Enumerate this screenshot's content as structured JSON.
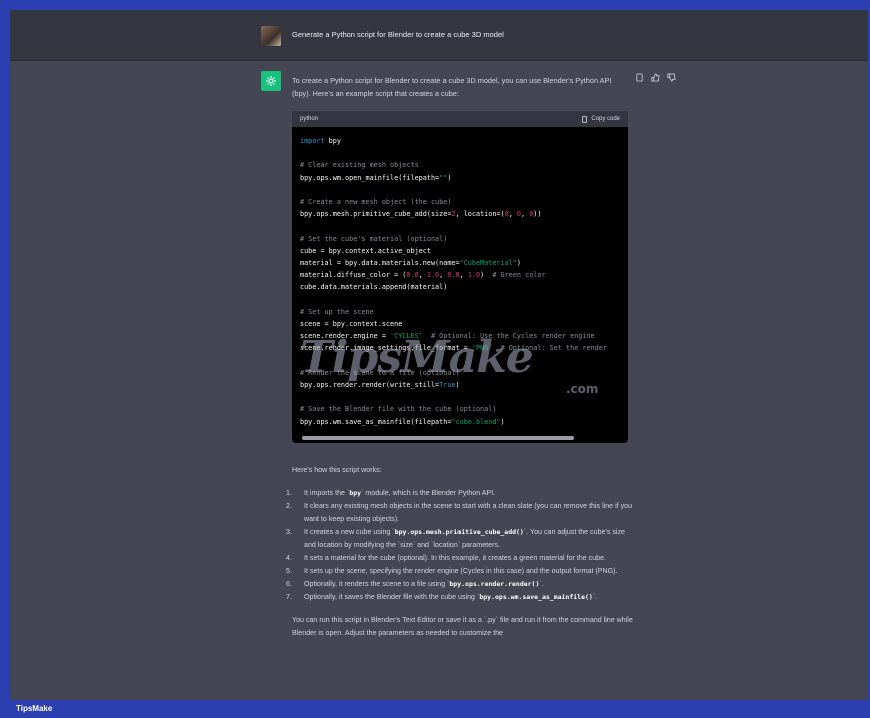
{
  "user_message": "Generate a Python script for Blender to create a cube 3D model",
  "intro": "To create a Python script for Blender to create a cube 3D model, you can use Blender's Python API (bpy). Here's an example script that creates a cube:",
  "code_block": {
    "language": "python",
    "copy_label": "Copy code"
  },
  "how_heading": "Here's how this script works:",
  "steps": [
    {
      "num": "1.",
      "pre": "It imports the `",
      "code": "bpy",
      "post": "` module, which is the Blender Python API."
    },
    {
      "num": "2.",
      "pre": "It clears any existing mesh objects in the scene to start with a clean slate (you can remove this line if you want to keep existing objects).",
      "code": "",
      "post": ""
    },
    {
      "num": "3.",
      "pre": "It creates a new cube using `",
      "code": "bpy.ops.mesh.primitive_cube_add()",
      "post": "`. You can adjust the cube's size and location by modifying the `size` and `location` parameters."
    },
    {
      "num": "4.",
      "pre": "It sets a material for the cube (optional). In this example, it creates a green material for the cube.",
      "code": "",
      "post": ""
    },
    {
      "num": "5.",
      "pre": "It sets up the scene, specifying the render engine (Cycles in this case) and the output format (PNG).",
      "code": "",
      "post": ""
    },
    {
      "num": "6.",
      "pre": "Optionally, it renders the scene to a file using `",
      "code": "bpy.ops.render.render()",
      "post": "`."
    },
    {
      "num": "7.",
      "pre": "Optionally, it saves the Blender file with the cube using `",
      "code": "bpy.ops.wm.save_as_mainfile()",
      "post": "`."
    }
  ],
  "outro": "You can run this script in Blender's Text Editor or save it as a `.py` file and run it from the command line while Blender is open. Adjust the parameters as needed to customize the",
  "watermark": "TipsMake",
  "watermark_sub": ".com",
  "footer_brand": "TipsMake",
  "colors": {
    "bot_avatar": "#19c37d",
    "page_frame": "#2c3fb0"
  }
}
